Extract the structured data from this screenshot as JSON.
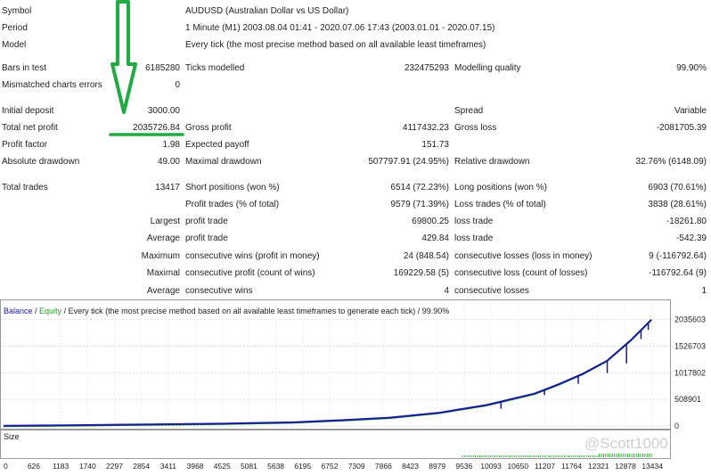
{
  "header": {
    "symbol_label": "Symbol",
    "symbol_value": "AUDUSD (Australian Dollar vs US Dollar)",
    "period_label": "Period",
    "period_value": "1 Minute (M1) 2003.08.04 01:41 - 2020.07.06 17:43 (2003.01.01 - 2020.07.15)",
    "model_label": "Model",
    "model_value": "Every tick (the most precise method based on all available least timeframes)"
  },
  "stats": {
    "bars_label": "Bars in test",
    "bars_value": "6185280",
    "ticks_label": "Ticks modelled",
    "ticks_value": "232475293",
    "quality_label": "Modelling quality",
    "quality_value": "99.90%",
    "mismatch_label": "Mismatched charts errors",
    "mismatch_value": "0",
    "deposit_label": "Initial deposit",
    "deposit_value": "3000.00",
    "spread_label": "Spread",
    "spread_value": "Variable",
    "netprofit_label": "Total net profit",
    "netprofit_value": "2035726.84",
    "grossprofit_label": "Gross profit",
    "grossprofit_value": "4117432.23",
    "grossloss_label": "Gross loss",
    "grossloss_value": "-2081705.39",
    "pf_label": "Profit factor",
    "pf_value": "1.98",
    "expected_label": "Expected payoff",
    "expected_value": "151.73",
    "absdd_label": "Absolute drawdown",
    "absdd_value": "49.00",
    "maxdd_label": "Maximal drawdown",
    "maxdd_value": "507797.91 (24.95%)",
    "reldd_label": "Relative drawdown",
    "reldd_value": "32.76% (6148.09)",
    "trades_label": "Total trades",
    "trades_value": "13417",
    "short_label": "Short positions (won %)",
    "short_value": "6514 (72.23%)",
    "long_label": "Long positions (won %)",
    "long_value": "6903 (70.61%)",
    "ptrades_label": "Profit trades (% of total)",
    "ptrades_value": "9579 (71.39%)",
    "ltrades_label": "Loss trades (% of total)",
    "ltrades_value": "3838 (28.61%)",
    "largest_label": "Largest",
    "largest_profit_label": "profit trade",
    "largest_profit_value": "69800.25",
    "largest_loss_label": "loss trade",
    "largest_loss_value": "-18261.80",
    "average_label": "Average",
    "average_profit_label": "profit trade",
    "average_profit_value": "429.84",
    "average_loss_label": "loss trade",
    "average_loss_value": "-542.39",
    "maximum_label": "Maximum",
    "max_wins_label": "consecutive wins (profit in money)",
    "max_wins_value": "24 (848.54)",
    "max_losses_label": "consecutive losses (loss in money)",
    "max_losses_value": "9 (-116792.64)",
    "maximal_label": "Maximal",
    "mxl_profit_label": "consecutive profit (count of wins)",
    "mxl_profit_value": "169229.58 (5)",
    "mxl_loss_label": "consecutive loss (count of losses)",
    "mxl_loss_value": "-116792.64 (9)",
    "average2_label": "Average",
    "avg_wins_label": "consecutive wins",
    "avg_wins_value": "4",
    "avg_losses_label": "consecutive losses",
    "avg_losses_value": "1"
  },
  "colors": {
    "balance": "#1a1a9a",
    "equity": "#22a022",
    "annotation": "#22aa44",
    "size_bars": "#2eaa2e"
  },
  "chart_data": {
    "type": "line",
    "legend": {
      "balance": "Balance",
      "sep": " / ",
      "equity": "Equity",
      "rest": " / Every tick (the most precise method based on all available least timeframes to generate each tick) / 99.90%"
    },
    "series": [
      {
        "name": "Balance",
        "x": [
          0,
          1500,
          3000,
          4500,
          6000,
          7000,
          8000,
          9000,
          10000,
          11000,
          11500,
          12000,
          12500,
          13000,
          13417
        ],
        "values": [
          3000,
          15000,
          30000,
          45000,
          70000,
          110000,
          160000,
          250000,
          400000,
          620000,
          800000,
          1000000,
          1250000,
          1650000,
          2035726
        ]
      }
    ],
    "yticks": [
      0,
      508901,
      1017802,
      1526703,
      2035603
    ],
    "ytick_labels": [
      "0",
      "508901",
      "1017802",
      "1526703",
      "2035603"
    ],
    "ylim": [
      0,
      2080000
    ],
    "xticks": [
      0,
      626,
      1183,
      1740,
      2297,
      2854,
      3411,
      3968,
      4525,
      5081,
      5638,
      6195,
      6752,
      7309,
      7866,
      8423,
      8979,
      9536,
      10093,
      10650,
      11207,
      11764,
      12321,
      12878,
      13434
    ],
    "xlim": [
      0,
      13800
    ],
    "size_label": "Size"
  },
  "watermark": "@Scott1000"
}
